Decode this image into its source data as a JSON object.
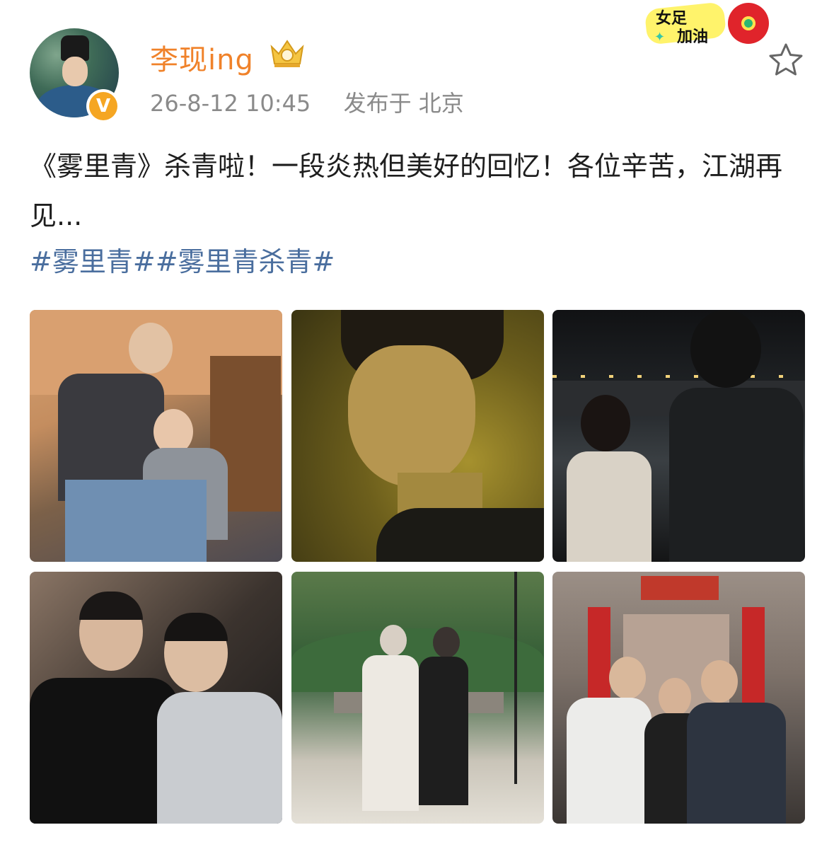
{
  "user": {
    "name": "李现ing",
    "vip_icon": "crown-vip-icon",
    "verified_label": "V",
    "timestamp": "26-8-12 10:45",
    "location": "发布于 北京"
  },
  "sticker": {
    "line1": "女足",
    "line2": "加油"
  },
  "post": {
    "text": "《雾里青》杀青啦！一段炎热但美好的回忆！各位辛苦，江湖再见...",
    "tags": [
      "#雾里青#",
      "#雾里青杀青#"
    ]
  },
  "icons": {
    "favorite": "star-outline-icon"
  },
  "colors": {
    "username": "#f0822a",
    "meta": "#8a8a8a",
    "tag": "#4a6e9e",
    "body_text": "#1e1e1e"
  },
  "photos": [
    {
      "name": "photo-1"
    },
    {
      "name": "photo-2"
    },
    {
      "name": "photo-3"
    },
    {
      "name": "photo-4"
    },
    {
      "name": "photo-5"
    },
    {
      "name": "photo-6"
    }
  ]
}
